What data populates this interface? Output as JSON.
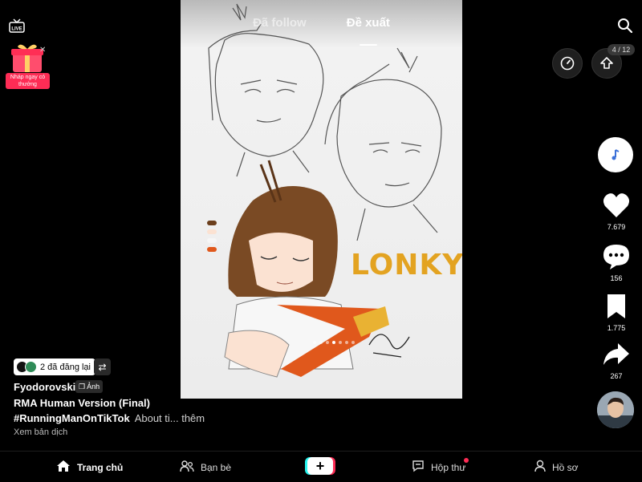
{
  "tabs": {
    "following": "Đã follow",
    "for_you": "Đề xuất"
  },
  "promo": {
    "label": "Nháp ngay có thưởng"
  },
  "media": {
    "artwork_title": "LONKY",
    "pagination": "4 / 12",
    "slide_count": 7,
    "active_slide": 3
  },
  "actions": {
    "likes": "7.679",
    "comments": "156",
    "saves": "1.775",
    "shares": "267"
  },
  "post": {
    "repost_text": "2 đã đăng lại",
    "author": "Fyodorovski",
    "photo_badge": "Ảnh",
    "caption": "RMA Human Version (Final)",
    "hashtag": "#RunningManOnTikTok",
    "about": "About ti... thêm",
    "translate": "Xem bản dịch"
  },
  "nav": {
    "home": "Trang chủ",
    "friends": "Bạn bè",
    "inbox": "Hộp thư",
    "profile": "Hồ sơ"
  },
  "colors": {
    "accent_red": "#fe2c55",
    "accent_cyan": "#25f4ee",
    "background": "#000000"
  },
  "icons": [
    "live-icon",
    "gift-icon",
    "search-icon",
    "speedometer-icon",
    "arrow-up-icon",
    "music-icon",
    "heart-icon",
    "comment-icon",
    "bookmark-icon",
    "share-icon",
    "home-icon",
    "friends-icon",
    "plus-icon",
    "inbox-icon",
    "profile-icon",
    "repost-icon"
  ]
}
